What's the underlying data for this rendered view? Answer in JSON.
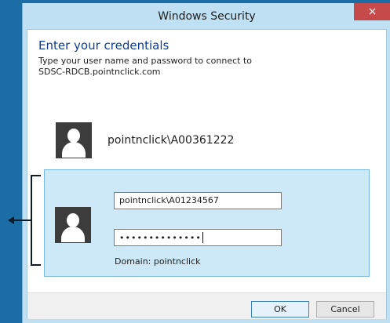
{
  "window": {
    "title": "Windows Security",
    "close_label": "×"
  },
  "dialog": {
    "heading": "Enter your credentials",
    "subtext_line1": "Type your user name and password to connect to",
    "subtext_line2": "SDSC-RDCB.pointnclick.com"
  },
  "tiles": [
    {
      "account": "pointnclick\\A00361222",
      "icon": "user-avatar-icon"
    }
  ],
  "selected_tile": {
    "username_value": "pointnclick\\A01234567",
    "password_mask": "••••••••••••••",
    "domain_label": "Domain: pointnclick",
    "icon": "user-avatar-icon"
  },
  "buttons": {
    "ok": "OK",
    "cancel": "Cancel"
  },
  "colors": {
    "desktop": "#1b6ea5",
    "frame": "#bfe0f2",
    "selected_tile": "#cde8f7",
    "heading": "#0b3d96",
    "close_button": "#c74a4a"
  }
}
